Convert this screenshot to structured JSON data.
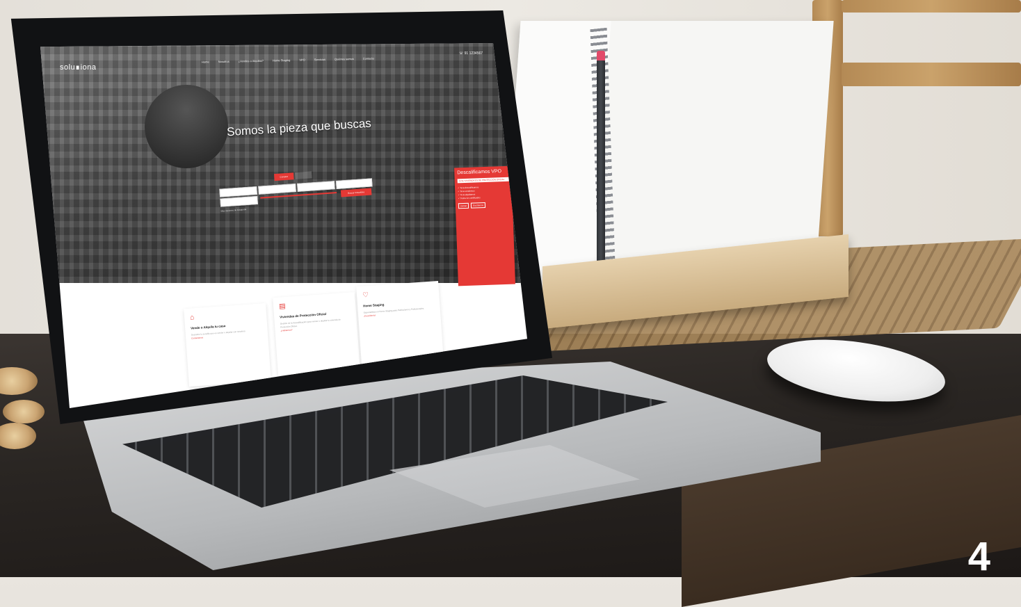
{
  "page_number": "4",
  "website": {
    "logo": "solu∎iona",
    "nav": [
      "Home",
      "Nosotros",
      "¿Vendes o Alquilas?",
      "Home Staging",
      "VPO",
      "Servicios",
      "Quiénes somos",
      "Contacto"
    ],
    "phone": "☏ 91 1234567",
    "hero_title": "Somos la pieza que buscas",
    "search": {
      "tab_active": "Comprar",
      "button": "Buscar Inmuebles",
      "more": "Más opciones de búsqueda"
    },
    "promo": {
      "title": "Descalificamos VPO",
      "subtitle": "SI SU VIVIENDA ES DE PROTECCIÓN OFICIAL",
      "bullets": [
        "✓ Te la descalificamos",
        "✓ Te la vendemos",
        "✓ Te la alquilamos",
        "✓ Todos los certificados"
      ],
      "cta_primary": "Llamar",
      "cta_secondary": "Escríbenos"
    },
    "cards": [
      {
        "icon": "house-icon",
        "title": "Vende o Alquila tu casa",
        "desc": "Descubre lo sencillo que es vender o alquilar con nosotros.",
        "link": "Contactanos"
      },
      {
        "icon": "document-icon",
        "title": "Viviendas de Protección Oficial",
        "desc": "Gestión de la descalificación para vender o alquilar tu vivienda de Protección Oficial.",
        "link": "¿Hablamos?"
      },
      {
        "icon": "heart-icon",
        "title": "Home Staging",
        "desc": "Especialistas en Home Staging para Particulares y Profesionales.",
        "link": "¡Descúbrelo!"
      }
    ]
  },
  "colors": {
    "accent": "#e53935"
  }
}
